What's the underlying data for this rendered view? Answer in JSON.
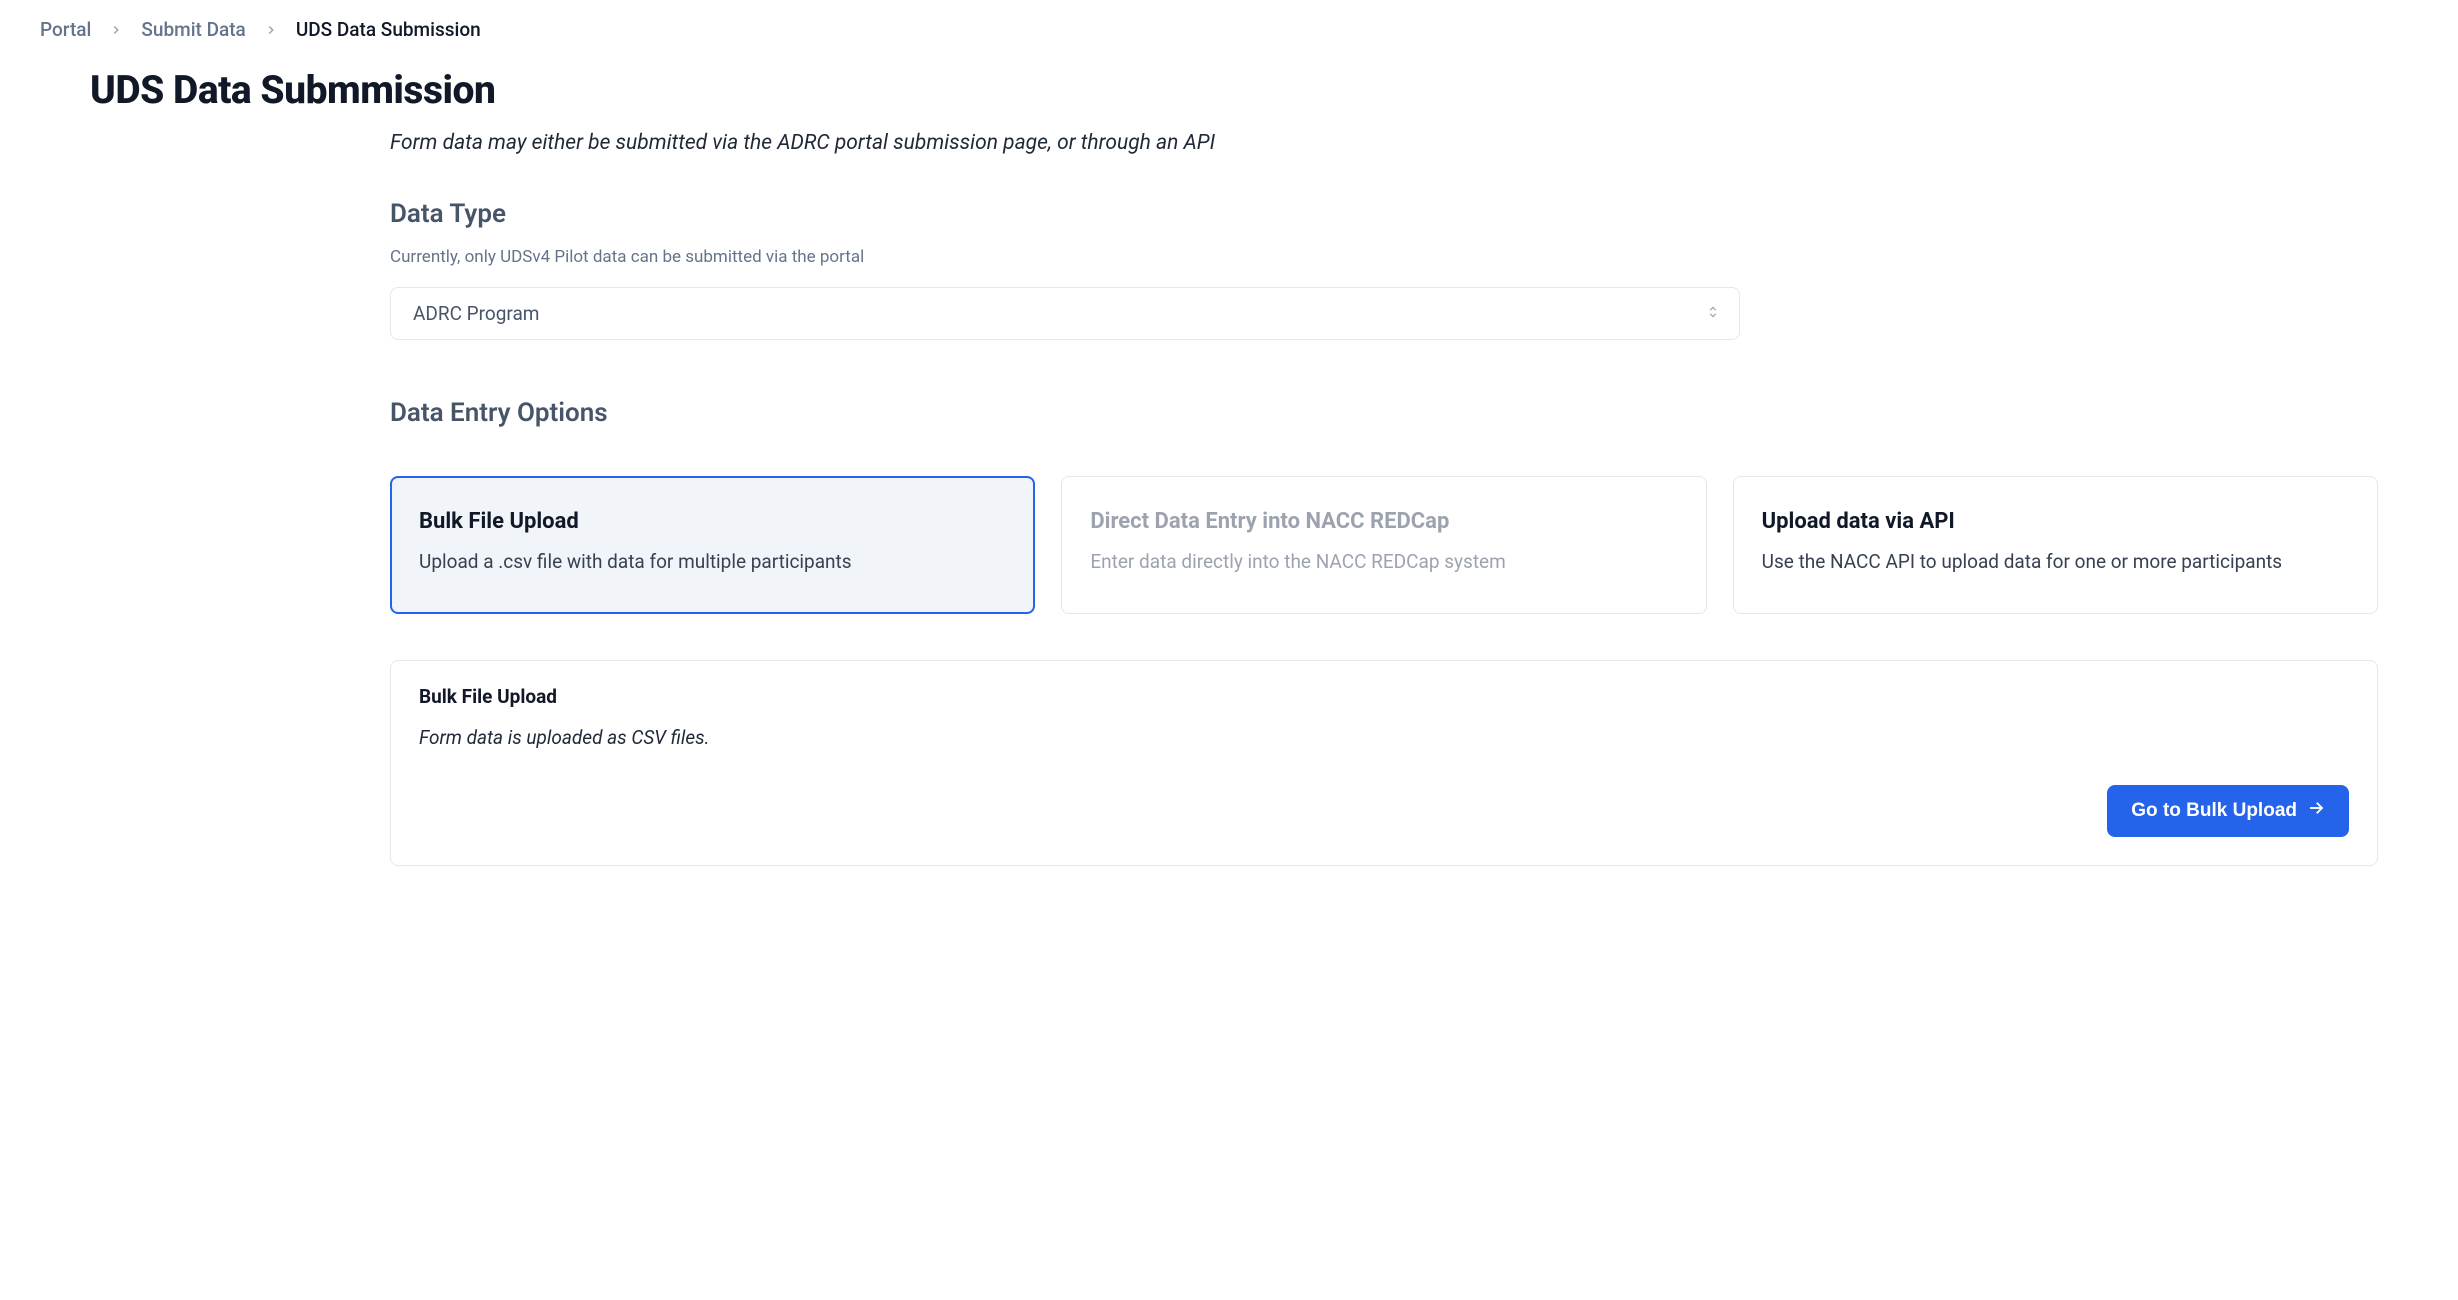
{
  "breadcrumb": {
    "items": [
      {
        "label": "Portal",
        "current": false
      },
      {
        "label": "Submit Data",
        "current": false
      },
      {
        "label": "UDS Data Submission",
        "current": true
      }
    ]
  },
  "page": {
    "title": "UDS Data Submmission",
    "intro": "Form data may either be submitted via the ADRC portal submission page, or through an API"
  },
  "data_type": {
    "heading": "Data Type",
    "subtext": "Currently, only UDSv4 Pilot data can be submitted via the portal",
    "selected": "ADRC Program"
  },
  "options": {
    "heading": "Data Entry Options",
    "cards": [
      {
        "title": "Bulk File Upload",
        "desc": "Upload a .csv file with data for multiple participants",
        "state": "selected"
      },
      {
        "title": "Direct Data Entry into NACC REDCap",
        "desc": "Enter data directly into the NACC REDCap system",
        "state": "disabled"
      },
      {
        "title": "Upload data via API",
        "desc": "Use the NACC API to upload data for one or more participants",
        "state": "default"
      }
    ]
  },
  "detail": {
    "title": "Bulk File Upload",
    "desc": "Form data is uploaded as CSV files.",
    "button_label": "Go to Bulk Upload"
  }
}
